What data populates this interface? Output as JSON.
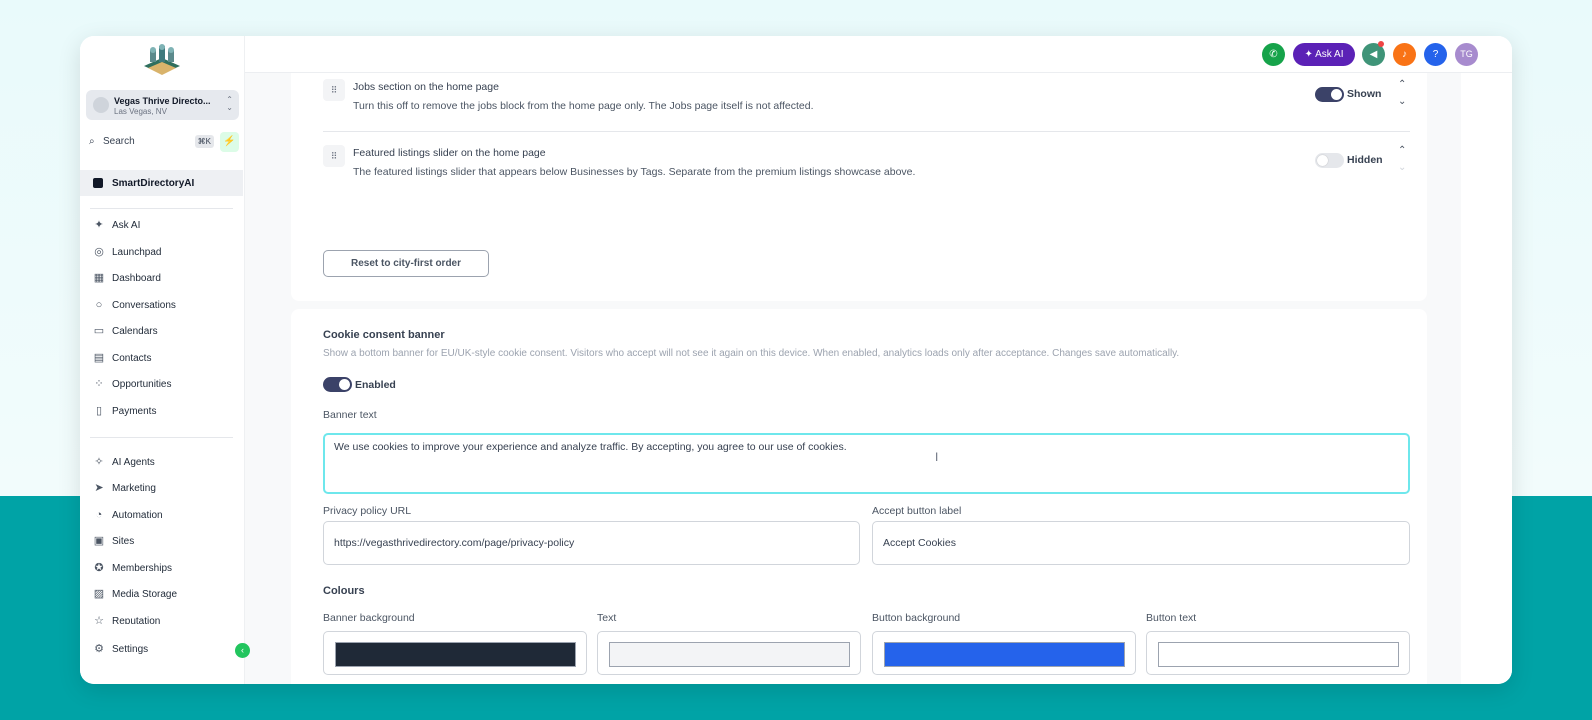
{
  "sidebar": {
    "location_name": "Vegas Thrive Directo...",
    "location_city": "Las Vegas, NV",
    "search_label": "Search",
    "search_shortcut": "⌘K",
    "brand": "SmartDirectoryAI",
    "nav_group1": [
      "Ask AI",
      "Launchpad",
      "Dashboard",
      "Conversations",
      "Calendars",
      "Contacts",
      "Opportunities",
      "Payments"
    ],
    "nav_group2": [
      "AI Agents",
      "Marketing",
      "Automation",
      "Sites",
      "Memberships",
      "Media Storage",
      "Reputation"
    ],
    "settings": "Settings"
  },
  "topbar": {
    "ask_ai": "Ask AI",
    "help": "?",
    "avatar_initials": "TG"
  },
  "sections": {
    "jobs": {
      "title": "Jobs section on the home page",
      "description": "Turn this off to remove the jobs block from the home page only. The Jobs page itself is not affected.",
      "state": "Shown"
    },
    "featured": {
      "title": "Featured listings slider on the home page",
      "description": "The featured listings slider that appears below Businesses by Tags. Separate from the premium listings showcase above.",
      "state": "Hidden"
    },
    "reset_button": "Reset to city-first order"
  },
  "cookie": {
    "title": "Cookie consent banner",
    "description": "Show a bottom banner for EU/UK-style cookie consent. Visitors who accept will not see it again on this device. When enabled, analytics loads only after acceptance. Changes save automatically.",
    "toggle_label": "Enabled",
    "banner_text_label": "Banner text",
    "banner_text": "We use cookies to improve your experience and analyze traffic. By accepting, you agree to our use of cookies.",
    "privacy_label": "Privacy policy URL",
    "privacy_url": "https://vegasthrivedirectory.com/page/privacy-policy",
    "accept_label": "Accept button label",
    "accept_value": "Accept Cookies",
    "colours_title": "Colours",
    "colours": [
      {
        "label": "Banner background",
        "color": "#1f2937"
      },
      {
        "label": "Text",
        "color": "#f3f4f6"
      },
      {
        "label": "Button background",
        "color": "#2563eb"
      },
      {
        "label": "Button text",
        "color": "#ffffff"
      }
    ]
  },
  "colors": {
    "accent": "#00a3a6",
    "toggle_on": "#3b4268",
    "focus_border": "#6ee7ec"
  }
}
